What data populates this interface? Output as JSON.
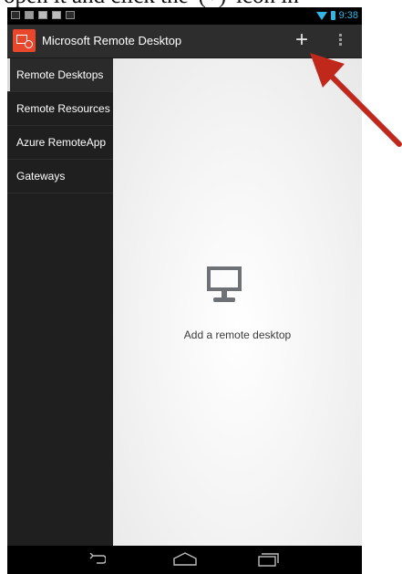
{
  "caption": {
    "text": "open it and click the '(+)' icon in"
  },
  "status_bar": {
    "notification_icons": [
      "image-icon",
      "mail-icon",
      "check-icon",
      "check-icon",
      "calendar-icon"
    ],
    "time": "9:38",
    "accent_color": "#33b5e5"
  },
  "action_bar": {
    "title": "Microsoft Remote Desktop",
    "add_label": "+",
    "brand_color": "#e8472c"
  },
  "sidebar": {
    "items": [
      {
        "label": "Remote Desktops",
        "active": true
      },
      {
        "label": "Remote Resources",
        "active": false
      },
      {
        "label": "Azure RemoteApp",
        "active": false
      },
      {
        "label": "Gateways",
        "active": false
      }
    ]
  },
  "content": {
    "empty_icon": "monitor-icon",
    "empty_label": "Add a remote desktop"
  },
  "nav_bar": {
    "buttons": [
      "back-icon",
      "home-icon",
      "recents-icon"
    ]
  },
  "annotation": {
    "icon": "red-arrow-icon",
    "color": "#c0281c"
  }
}
